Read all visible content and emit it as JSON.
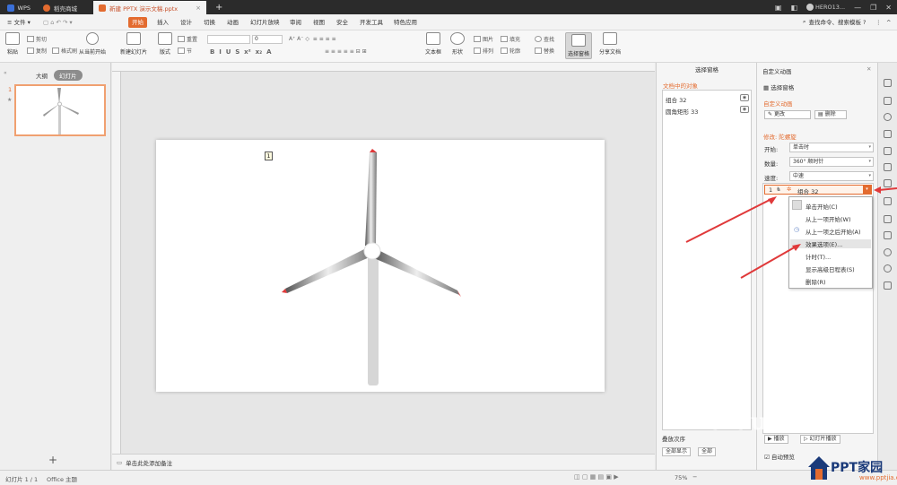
{
  "titlebar": {
    "tabs": [
      {
        "label": "WPS"
      },
      {
        "label": "稻壳商城"
      },
      {
        "label": "新建 PPTX 演示文稿.pptx"
      }
    ],
    "new_tab": "+",
    "user": "HERO13..."
  },
  "menubar": {
    "file": "≡ 文件 ▾",
    "items": [
      "开始",
      "插入",
      "设计",
      "切换",
      "动画",
      "幻灯片放映",
      "审阅",
      "视图",
      "安全",
      "开发工具",
      "特色应用"
    ],
    "active": "开始",
    "search": "查找命令、搜索模板"
  },
  "ribbon": {
    "paste": "粘贴",
    "cut": "剪切",
    "copy": "复制",
    "format_painter": "格式刷",
    "from_current": "从当前开始",
    "new_slide": "新建幻灯片",
    "layout": "版式",
    "reset": "重置",
    "section": "节",
    "textbox": "文本框",
    "shape": "形状",
    "arrange": "排列",
    "picture": "图片",
    "fill": "填充",
    "outline": "轮廓",
    "find": "查找",
    "replace": "替换",
    "selection_pane": "选择窗格",
    "share": "分享文档",
    "font_size": "0"
  },
  "leftpane": {
    "tab_outline": "大纲",
    "tab_slides": "幻灯片",
    "slide_number": "1",
    "add": "+"
  },
  "slide": {
    "anim_tag": "1"
  },
  "notes": {
    "placeholder": "单击此处添加备注"
  },
  "selection_pane": {
    "title": "选择窗格",
    "subtitle": "文档中的对象",
    "objects": [
      "组合 32",
      "圆角矩形 33"
    ],
    "order_label": "叠放次序",
    "show_all": "全部显示",
    "hide_all": "全部"
  },
  "anim_pane": {
    "title": "自定义动画",
    "select_pane": "选择窗格",
    "section_custom": "自定义动画",
    "change": "更改",
    "delete": "删除",
    "modify_label": "修改: 陀螺旋",
    "start_label": "开始:",
    "start_value": "单击时",
    "amount_label": "数量:",
    "amount_value": "360° 顺时针",
    "speed_label": "速度:",
    "speed_value": "中速",
    "item": {
      "index": "1",
      "name": "组合 32"
    },
    "play": "播放",
    "slideshow": "幻灯片播放",
    "autopreview": "自动预览"
  },
  "dropdown_menu": {
    "items": [
      "单击开始(C)",
      "从上一项开始(W)",
      "从上一项之后开始(A)",
      "效果选项(E)...",
      "计时(T)...",
      "显示高级日程表(S)",
      "删除(R)"
    ],
    "highlighted": 3
  },
  "status": {
    "slide_info": "幻灯片 1 / 1",
    "theme": "Office 主题",
    "zoom": "75%"
  },
  "watermark": {
    "brand": "PPT家园",
    "url": "www.pptjia.com",
    "baidu": "Baidu"
  },
  "colors": {
    "accent": "#e36b2f",
    "arrow": "#e0393a"
  }
}
